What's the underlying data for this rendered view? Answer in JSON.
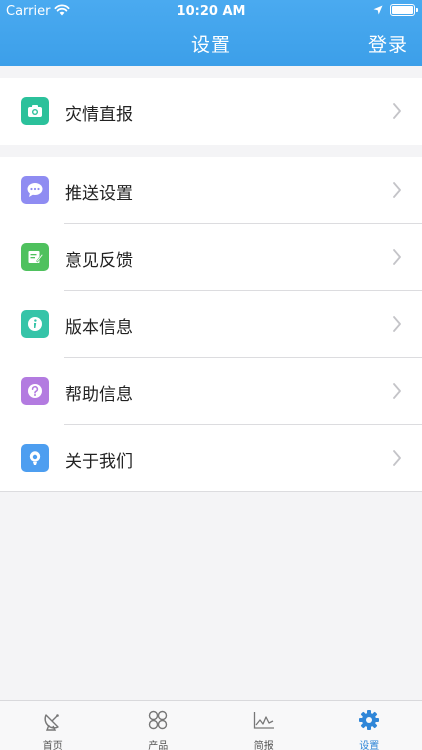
{
  "status_bar": {
    "carrier": "Carrier",
    "time": "10:20 AM"
  },
  "nav": {
    "title": "设置",
    "login": "登录"
  },
  "section1": [
    {
      "label": "灾情直报",
      "icon": "camera-icon",
      "color": "#2bc19b"
    }
  ],
  "section2": [
    {
      "label": "推送设置",
      "icon": "chat-bubble-icon",
      "color": "#8f8cf2"
    },
    {
      "label": "意见反馈",
      "icon": "feedback-edit-icon",
      "color": "#4fc15e"
    },
    {
      "label": "版本信息",
      "icon": "info-icon",
      "color": "#35c4a8"
    },
    {
      "label": "帮助信息",
      "icon": "help-question-icon",
      "color": "#b37be0"
    },
    {
      "label": "关于我们",
      "icon": "person-about-icon",
      "color": "#4d9ef0"
    }
  ],
  "tabs": [
    {
      "label": "首页",
      "icon": "satellite-dish-icon",
      "active": false
    },
    {
      "label": "产品",
      "icon": "grid-products-icon",
      "active": false
    },
    {
      "label": "简报",
      "icon": "line-chart-icon",
      "active": false
    },
    {
      "label": "设置",
      "icon": "gear-icon",
      "active": true
    }
  ],
  "colors": {
    "nav_bg": "#3c9fe9",
    "active_tab": "#2f86d8",
    "page_bg": "#f4f4f6"
  }
}
